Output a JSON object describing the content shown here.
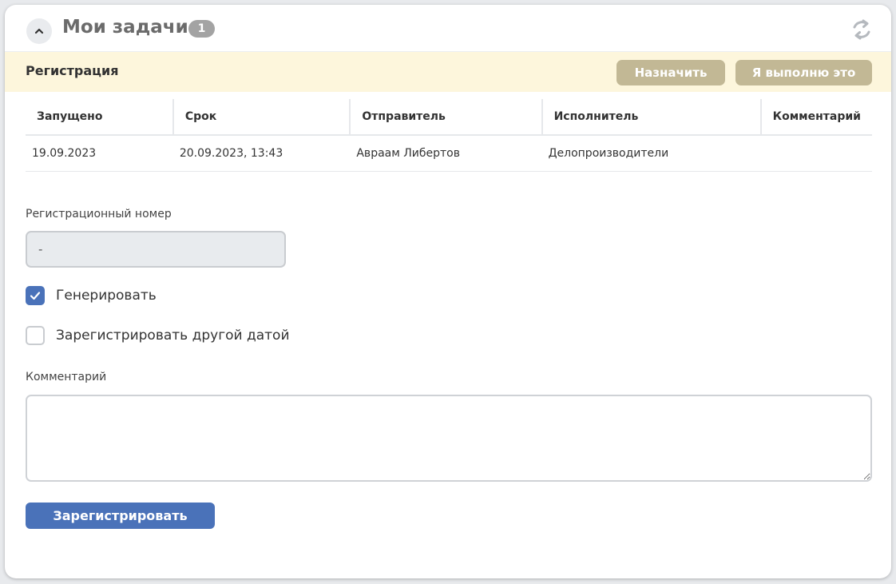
{
  "header": {
    "title": "Мои задачи",
    "count": "1",
    "collapse_icon": "chevron-up-icon",
    "refresh_icon": "refresh-icon"
  },
  "task": {
    "name": "Регистрация",
    "assign_label": "Назначить",
    "self_label": "Я выполню это"
  },
  "table": {
    "columns": [
      "Запущено",
      "Срок",
      "Отправитель",
      "Исполнитель",
      "Комментарий"
    ],
    "rows": [
      [
        "19.09.2023",
        "20.09.2023, 13:43",
        "Авраам Либертов",
        "Делопроизводители",
        ""
      ]
    ]
  },
  "form": {
    "reg_number_label": "Регистрационный номер",
    "reg_number_value": "-",
    "generate_label": "Генерировать",
    "generate_checked": true,
    "other_date_label": "Зарегистрировать другой датой",
    "other_date_checked": false,
    "comment_label": "Комментарий",
    "comment_value": "",
    "submit_label": "Зарегистрировать"
  },
  "colors": {
    "accent": "#4a72b9",
    "task_bar": "#fdf6dc",
    "secondary_button": "#c2b895",
    "badge": "#a3a3a3"
  }
}
